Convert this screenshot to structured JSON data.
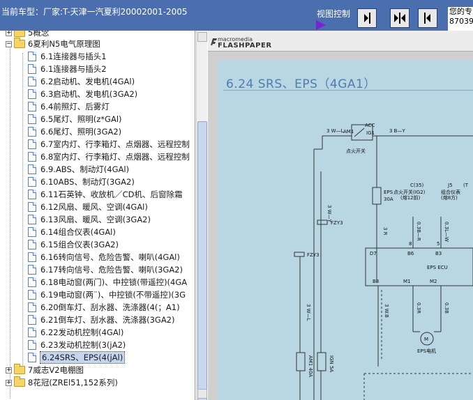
{
  "header": {
    "current_car": "当前车型：厂家:T-天津一汽夏利20002001-2005",
    "view_control": "视图控制",
    "right_panel_lines": [
      "您的专",
      "87039"
    ]
  },
  "tree": {
    "partial_top": "5概念",
    "parent_folder": "6夏利N5电气原理图",
    "items": [
      "6.1连接器与插头1",
      "6.1连接器与插头2",
      "6.2启动机、发电机(4GAl)",
      "6.3启动机、发电机(3GA2)",
      "6.4前照灯、后雾灯",
      "6.5尾灯、照明(z*GAl)",
      "6.6尾灯、照明(3GA2)",
      "6.7室内灯、行李箱灯、点烟器、远程控制",
      "6.8室内灯、行李箱灯、点烟器、远程控制",
      "6.9.ABS、制动灯(4GAl)",
      "6.10ABS、制动灯(3GA2)",
      "6.11石英钟、收放机／CD机、后窗除霜",
      "6.12风扇、暖风、空调(4GAl)",
      "6.13风扇、暖风、空调(3GA2)",
      "6.14组合仪表(4GAl)",
      "6.15组合仪表(3GA2)",
      "6.16转向信号、危险告警、喇叭(4GAl)",
      "6.17转向信号、危险告警、喇叭(3GA2)",
      "6.18电动窗(两门)、中控锁(带遥控)(4GA",
      "6.19电动窗(两¨)、中控锁(不带遥控)(3G",
      "6.20倒车灯、刮水器、洗涤器(4(；A1)",
      "6.21倒车灯、刮水器、洗涤器(3GA2)",
      "6.22发动机控制(4GAl)",
      "6.23发动机控制(3(jA2)",
      "6.24SRS、EPS(4(jAl)"
    ],
    "selected_index": 24,
    "siblings": [
      "7威志V2电棚图",
      "8花冠(ZREl51,152系列)"
    ]
  },
  "viewer": {
    "logo_top": "macromedia",
    "logo_bottom": "FLASHPAPER",
    "page_title": "6.24   SRS、EPS（4GA1）",
    "schematic": {
      "wire_3wl": "3 W—L",
      "wire_3by": "3 B—Y",
      "am1": "AM1",
      "acc": "ACC",
      "ig1": "IG1",
      "ignition_switch": "点火开关",
      "c35": "C(35)",
      "j5": "J5",
      "tag_t": "(T",
      "ign_switch_ig2": "点火开关(IG2)",
      "combo_meter": "组合仪表",
      "fuse_12": "(熔12前)",
      "fuse_8": "(熔8方)",
      "eps_fuse": "EPS",
      "eps_fuse_amp": "30A",
      "wire_3wy": "3 W—Y",
      "wire_3r": "3 R",
      "wire_03br": "0.3B—R",
      "wire_03lw": "0.3L—W",
      "fzy3": "FZY3",
      "fzy3_b": "FZY3",
      "pin_d7": "D7",
      "pin_b6": "B6",
      "pin_b3": "B3",
      "pin_b8": "B8",
      "pin_m1": "M1",
      "pin_m2": "M2",
      "num_8": "8",
      "num_5": "5",
      "eps_ecu": "EPS ECU",
      "wire_3wl_b": "3 W—L",
      "wire_3wb": "3 W.B",
      "wire_03r": "0.3R",
      "wire_03b": "0.3B",
      "motor": "M",
      "eps_motor": "EPS电机",
      "fuse_am1": "AM1 40A",
      "fuse_ignb": "IGN 5A"
    }
  }
}
